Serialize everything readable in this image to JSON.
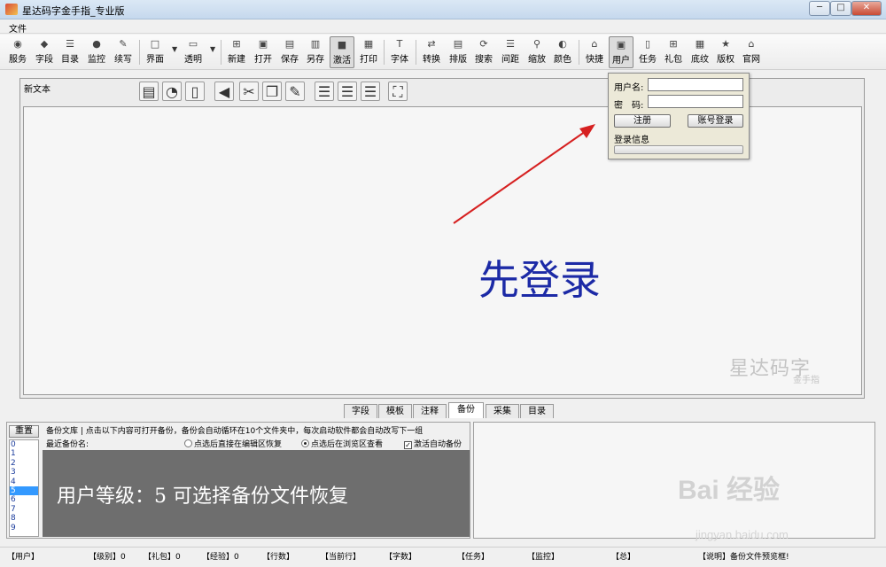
{
  "window": {
    "title": "星达码字金手指_专业版",
    "min_label": "─",
    "max_label": "□",
    "close_label": "✕"
  },
  "menu": {
    "file": "文件"
  },
  "toolbar": {
    "items": [
      {
        "label": "服务",
        "icon": "rss-icon"
      },
      {
        "label": "字段",
        "icon": "fields-icon"
      },
      {
        "label": "目录",
        "icon": "catalog-icon"
      },
      {
        "label": "监控",
        "icon": "monitor-icon"
      },
      {
        "label": "续写",
        "icon": "pen-icon"
      },
      {
        "label": "界面",
        "icon": "window-icon"
      },
      {
        "label": "透明",
        "icon": "transparency-icon"
      },
      {
        "label": "新建",
        "icon": "new-file-icon"
      },
      {
        "label": "打开",
        "icon": "open-icon"
      },
      {
        "label": "保存",
        "icon": "save-icon"
      },
      {
        "label": "另存",
        "icon": "save-as-icon"
      },
      {
        "label": "激活",
        "icon": "activate-icon"
      },
      {
        "label": "打印",
        "icon": "print-icon"
      },
      {
        "label": "字体",
        "icon": "font-icon"
      },
      {
        "label": "转换",
        "icon": "convert-icon"
      },
      {
        "label": "排版",
        "icon": "layout-icon"
      },
      {
        "label": "搜索",
        "icon": "search-icon"
      },
      {
        "label": "间距",
        "icon": "spacing-icon"
      },
      {
        "label": "缩放",
        "icon": "zoom-icon"
      },
      {
        "label": "颜色",
        "icon": "color-icon"
      },
      {
        "label": "快捷",
        "icon": "shortcut-icon"
      },
      {
        "label": "用户",
        "icon": "user-icon"
      },
      {
        "label": "任务",
        "icon": "task-icon"
      },
      {
        "label": "礼包",
        "icon": "gift-icon"
      },
      {
        "label": "底纹",
        "icon": "texture-icon"
      },
      {
        "label": "版权",
        "icon": "star-icon"
      },
      {
        "label": "官网",
        "icon": "website-icon"
      }
    ]
  },
  "editor": {
    "doc_name": "新文本",
    "main_text": "先登录",
    "watermark": "星达码字",
    "watermark_sub": "金手指"
  },
  "login": {
    "username_label": "用户名:",
    "password_label": "密　码:",
    "username_value": "",
    "password_value": "",
    "register_label": "注册",
    "login_label": "账号登录",
    "info_label": "登录信息"
  },
  "tabs": [
    "字段",
    "模板",
    "注释",
    "备份",
    "采集",
    "目录"
  ],
  "active_tab": "备份",
  "backup": {
    "reset_label": "重置",
    "list": [
      "0",
      "1",
      "2",
      "3",
      "4",
      "5",
      "6",
      "7",
      "8",
      "9"
    ],
    "selected_index": 5,
    "info": "备份文库 | 点击以下内容可打开备份，备份会自动循环在10个文件夹中，每次启动软件都会自动改写下一组",
    "recent_label": "最近备份名:",
    "option_restore": "点选后直接在编辑区恢复",
    "option_browse": "点选后在浏览区查看",
    "option_auto": "激活自动备份",
    "preview_message": "用户等级：5  可选择备份文件恢复"
  },
  "status": [
    {
      "label": "【用户】",
      "value": ""
    },
    {
      "label": "【级别】",
      "value": "0"
    },
    {
      "label": "【礼包】",
      "value": "0"
    },
    {
      "label": "【经验】",
      "value": "0"
    },
    {
      "label": "【行数】",
      "value": ""
    },
    {
      "label": "【当前行】",
      "value": ""
    },
    {
      "label": "【字数】",
      "value": ""
    },
    {
      "label": "【任务】",
      "value": ""
    },
    {
      "label": "【监控】",
      "value": ""
    },
    {
      "label": "【总】",
      "value": ""
    },
    {
      "label": "【说明】",
      "value": "备份文件预览框!"
    }
  ],
  "watermark_site": {
    "brand": "Bai 经验",
    "url": "jingyan.baidu.com"
  },
  "colors": {
    "main_text": "#1c2aa6",
    "arrow": "#d62020",
    "selection": "#3399ff"
  }
}
